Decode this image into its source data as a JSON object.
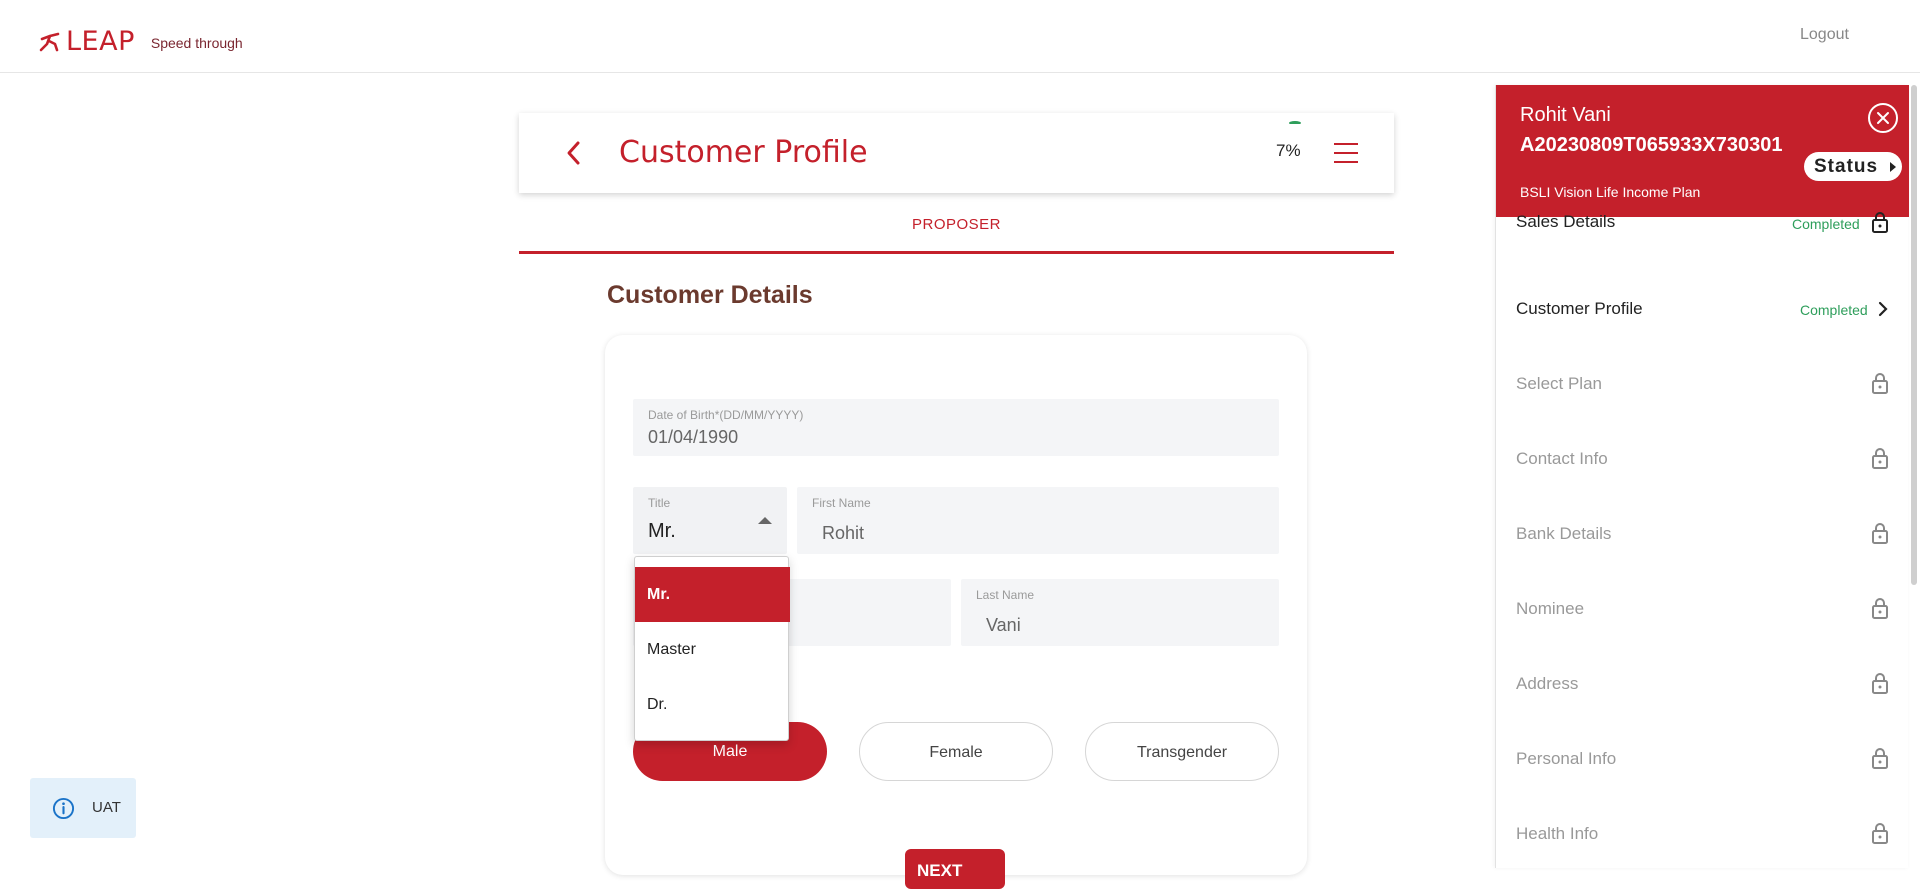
{
  "app": {
    "logo_text": "LEAP",
    "tagline": "Speed through",
    "logout_label": "Logout",
    "accent_color": "#c4202b"
  },
  "header": {
    "title": "Customer Profile",
    "progress": "7%"
  },
  "tabs": [
    {
      "label": "PROPOSER"
    }
  ],
  "section": {
    "title": "Customer Details"
  },
  "form": {
    "dob": {
      "label": "Date of Birth*(DD/MM/YYYY)",
      "value": "01/04/1990"
    },
    "title": {
      "label": "Title",
      "value": "Mr."
    },
    "first_name": {
      "label": "First Name",
      "value": "Rohit"
    },
    "last_name": {
      "label": "Last Name",
      "value": "Vani"
    },
    "gender_options": [
      "Male",
      "Female",
      "Transgender"
    ],
    "gender_selected": "Male",
    "next_label": "NEXT"
  },
  "title_dropdown": {
    "options": [
      "Mr.",
      "Master",
      "Dr."
    ],
    "selected": "Mr."
  },
  "env_badge": {
    "label": "UAT"
  },
  "side_panel": {
    "name": "Rohit Vani",
    "application_id": "A20230809T065933X730301",
    "plan": "BSLI Vision Life Income Plan",
    "status_label": "Status",
    "steps": [
      {
        "label": "Sales Details",
        "status": "Completed",
        "icon": "lock-icon"
      },
      {
        "label": "Customer Profile",
        "status": "Completed",
        "icon": "chevron-right-icon"
      },
      {
        "label": "Select Plan",
        "status": "",
        "icon": "lock-icon"
      },
      {
        "label": "Contact Info",
        "status": "",
        "icon": "lock-icon"
      },
      {
        "label": "Bank Details",
        "status": "",
        "icon": "lock-icon"
      },
      {
        "label": "Nominee",
        "status": "",
        "icon": "lock-icon"
      },
      {
        "label": "Address",
        "status": "",
        "icon": "lock-icon"
      },
      {
        "label": "Personal Info",
        "status": "",
        "icon": "lock-icon"
      },
      {
        "label": "Health Info",
        "status": "",
        "icon": "lock-icon"
      }
    ]
  }
}
